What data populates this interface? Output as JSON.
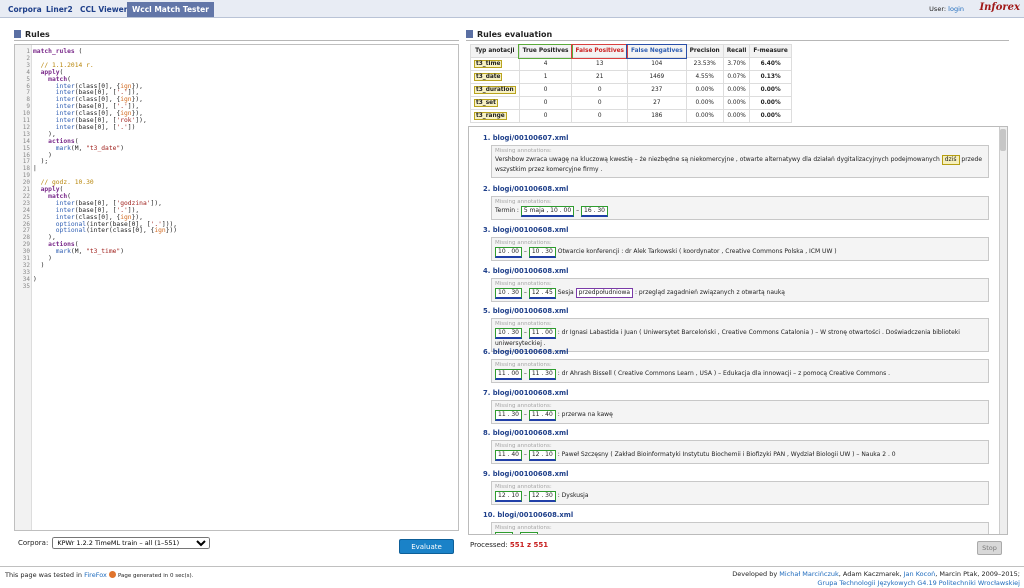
{
  "nav": {
    "tabs": [
      "Corpora",
      "Liner2",
      "CCL Viewer",
      "Wccl Match Tester"
    ],
    "active": 3,
    "user_label": "User:",
    "user_name": "login",
    "logo": "Inforex"
  },
  "rules_panel": {
    "title": "Rules"
  },
  "code_lines": [
    [
      {
        "t": "match_rules",
        "c": "kw"
      },
      {
        "t": " ("
      }
    ],
    [],
    [
      {
        "t": "  // 1.1.2014 r.",
        "c": "cm"
      }
    ],
    [
      {
        "t": "  apply",
        "c": "kw"
      },
      {
        "t": "("
      }
    ],
    [
      {
        "t": "    match",
        "c": "kw"
      },
      {
        "t": "("
      }
    ],
    [
      {
        "t": "      inter",
        "c": "fn"
      },
      {
        "t": "(class[0], {"
      },
      {
        "t": "ign",
        "c": "nm"
      },
      {
        "t": "}),"
      }
    ],
    [
      {
        "t": "      inter",
        "c": "fn"
      },
      {
        "t": "(base[0], ["
      },
      {
        "t": "'.'",
        "c": "st"
      },
      {
        "t": "]),"
      }
    ],
    [
      {
        "t": "      inter",
        "c": "fn"
      },
      {
        "t": "(class[0], {"
      },
      {
        "t": "ign",
        "c": "nm"
      },
      {
        "t": "}),"
      }
    ],
    [
      {
        "t": "      inter",
        "c": "fn"
      },
      {
        "t": "(base[0], ["
      },
      {
        "t": "'.'",
        "c": "st"
      },
      {
        "t": "]),"
      }
    ],
    [
      {
        "t": "      inter",
        "c": "fn"
      },
      {
        "t": "(class[0], {"
      },
      {
        "t": "ign",
        "c": "nm"
      },
      {
        "t": "}),"
      }
    ],
    [
      {
        "t": "      inter",
        "c": "fn"
      },
      {
        "t": "(base[0], ["
      },
      {
        "t": "'rok'",
        "c": "st"
      },
      {
        "t": "]),"
      }
    ],
    [
      {
        "t": "      inter",
        "c": "fn"
      },
      {
        "t": "(base[0], ["
      },
      {
        "t": "'.'",
        "c": "st"
      },
      {
        "t": "])"
      }
    ],
    [
      {
        "t": "    ),"
      }
    ],
    [
      {
        "t": "    actions",
        "c": "kw"
      },
      {
        "t": "("
      }
    ],
    [
      {
        "t": "      mark",
        "c": "fn"
      },
      {
        "t": "(M, "
      },
      {
        "t": "\"t3_date\"",
        "c": "st"
      },
      {
        "t": ")"
      }
    ],
    [
      {
        "t": "    )"
      }
    ],
    [
      {
        "t": "  );"
      }
    ],
    [
      {
        "t": "|"
      }
    ],
    [],
    [
      {
        "t": "  // godz. 10.30",
        "c": "cm"
      }
    ],
    [
      {
        "t": "  apply",
        "c": "kw"
      },
      {
        "t": "("
      }
    ],
    [
      {
        "t": "    match",
        "c": "kw"
      },
      {
        "t": "("
      }
    ],
    [
      {
        "t": "      inter",
        "c": "fn"
      },
      {
        "t": "(base[0], ["
      },
      {
        "t": "'godzina'",
        "c": "st"
      },
      {
        "t": "]),"
      }
    ],
    [
      {
        "t": "      inter",
        "c": "fn"
      },
      {
        "t": "(base[0], ["
      },
      {
        "t": "'.'",
        "c": "st"
      },
      {
        "t": "]),"
      }
    ],
    [
      {
        "t": "      inter",
        "c": "fn"
      },
      {
        "t": "(class[0], {"
      },
      {
        "t": "ign",
        "c": "nm"
      },
      {
        "t": "}),"
      }
    ],
    [
      {
        "t": "      optional",
        "c": "fn"
      },
      {
        "t": "(inter(base[0], ["
      },
      {
        "t": "'.'",
        "c": "st"
      },
      {
        "t": "])),"
      }
    ],
    [
      {
        "t": "      optional",
        "c": "fn"
      },
      {
        "t": "(inter(class[0], {"
      },
      {
        "t": "ign",
        "c": "nm"
      },
      {
        "t": "}))"
      }
    ],
    [
      {
        "t": "    ),"
      }
    ],
    [
      {
        "t": "    actions",
        "c": "kw"
      },
      {
        "t": "("
      }
    ],
    [
      {
        "t": "      mark",
        "c": "fn"
      },
      {
        "t": "(M, "
      },
      {
        "t": "\"t3_time\"",
        "c": "st"
      },
      {
        "t": ")"
      }
    ],
    [
      {
        "t": "    )"
      }
    ],
    [
      {
        "t": "  )"
      }
    ],
    [],
    [
      {
        "t": ")"
      }
    ],
    []
  ],
  "corpus": {
    "label": "Corpora:",
    "selected": "KPWr 1.2.2 TimeML train – all (1–551)"
  },
  "evaluate_label": "Evaluate",
  "eval_panel": {
    "title": "Rules evaluation"
  },
  "stats": {
    "headers": [
      "Typ anotacji",
      "True Positives",
      "False Positives",
      "False Negatives",
      "Precision",
      "Recall",
      "F-measure"
    ],
    "rows": [
      [
        "t3_time",
        "4",
        "13",
        "104",
        "23.53%",
        "3.70%",
        "6.40%"
      ],
      [
        "t3_date",
        "1",
        "21",
        "1469",
        "4.55%",
        "0.07%",
        "0.13%"
      ],
      [
        "t3_duration",
        "0",
        "0",
        "237",
        "0.00%",
        "0.00%",
        "0.00%"
      ],
      [
        "t3_set",
        "0",
        "0",
        "27",
        "0.00%",
        "0.00%",
        "0.00%"
      ],
      [
        "t3_range",
        "0",
        "0",
        "186",
        "0.00%",
        "0.00%",
        "0.00%"
      ]
    ]
  },
  "missing_label": "Missing annotations:",
  "results": [
    {
      "n": "1.",
      "file": "blogi/00100607.xml",
      "parts": [
        {
          "t": "Vershbow zwraca uwagę na kluczową kwestię – że niezbędne są niekomercyjne , otwarte alternatywy dla działań dygitalizacyjnych podejmowanych "
        },
        {
          "t": "dziś",
          "k": "dt"
        },
        {
          "t": " przede wszystkim przez komercyjne firmy ."
        }
      ]
    },
    {
      "n": "2.",
      "file": "blogi/00100608.xml",
      "parts": [
        {
          "t": "Termin : "
        },
        {
          "t": "5 maja , 10 . 00",
          "k": "tm"
        },
        {
          "t": " – "
        },
        {
          "t": "16 . 30",
          "k": "tm"
        }
      ]
    },
    {
      "n": "3.",
      "file": "blogi/00100608.xml",
      "parts": [
        {
          "t": "10 . 00",
          "k": "tm"
        },
        {
          "t": " – "
        },
        {
          "t": "10 . 30",
          "k": "tm"
        },
        {
          "t": " Otwarcie konferencji : dr Alek Tarkowski ( koordynator , Creative Commons Polska , ICM UW )"
        }
      ]
    },
    {
      "n": "4.",
      "file": "blogi/00100608.xml",
      "parts": [
        {
          "t": "10 . 30",
          "k": "tm"
        },
        {
          "t": " – "
        },
        {
          "t": "12 . 45",
          "k": "tm"
        },
        {
          "t": " Sesja "
        },
        {
          "t": "przedpołudniowa",
          "k": "pl"
        },
        {
          "t": " : przegląd zagadnień związanych z otwartą nauką"
        }
      ]
    },
    {
      "n": "5.",
      "file": "blogi/00100608.xml",
      "parts": [
        {
          "t": "10 . 30",
          "k": "tm"
        },
        {
          "t": " – "
        },
        {
          "t": "11 . 00",
          "k": "tm"
        },
        {
          "t": " : dr Ignasi Labastida i Juan ( Uniwersytet Barceloński , Creative Commons Catalonia ) – W stronę otwartości . Doświadczenia biblioteki uniwersyteckiej ."
        }
      ]
    },
    {
      "n": "6.",
      "file": "blogi/00100608.xml",
      "parts": [
        {
          "t": "11 . 00",
          "k": "tm"
        },
        {
          "t": " – "
        },
        {
          "t": "11 . 30",
          "k": "tm"
        },
        {
          "t": " : dr Ahrash Bissell ( Creative Commons Learn , USA ) – Edukacja dla innowacji – z pomocą Creative Commons ."
        }
      ]
    },
    {
      "n": "7.",
      "file": "blogi/00100608.xml",
      "parts": [
        {
          "t": "11 . 30",
          "k": "tm"
        },
        {
          "t": " – "
        },
        {
          "t": "11 . 40",
          "k": "tm"
        },
        {
          "t": " : przerwa na kawę"
        }
      ]
    },
    {
      "n": "8.",
      "file": "blogi/00100608.xml",
      "parts": [
        {
          "t": "11 . 40",
          "k": "tm"
        },
        {
          "t": " – "
        },
        {
          "t": "12 . 10",
          "k": "tm"
        },
        {
          "t": " : Paweł Szczęsny ( Zakład Bioinformatyki Instytutu Biochemii i Biofizyki PAN , Wydział Biologii UW ) – Nauka 2 . 0"
        }
      ]
    },
    {
      "n": "9.",
      "file": "blogi/00100608.xml",
      "parts": [
        {
          "t": "12 . 10",
          "k": "tm"
        },
        {
          "t": " – "
        },
        {
          "t": "12 . 30",
          "k": "tm"
        },
        {
          "t": " : Dyskusja"
        }
      ]
    },
    {
      "n": "10.",
      "file": "blogi/00100608.xml",
      "parts": [
        {
          "t": "",
          "k": "tm"
        },
        {
          "t": " – "
        },
        {
          "t": "",
          "k": "tm"
        }
      ]
    }
  ],
  "processed": {
    "label": "Processed:",
    "value": "551 z 551"
  },
  "stop_label": "Stop",
  "footer": {
    "tested_pre": "This page was tested in",
    "browser": "FireFox",
    "generated": "Page generated in 0 sec(s).",
    "developed": "Developed by",
    "authors": [
      "Michał Marcińczuk",
      ", Adam Kaczmarek, ",
      "Jan Kocoń",
      ", Marcin Ptak, 2009–2015;"
    ],
    "group": "Grupa Technologii Językowych G4.19 Politechniki Wrocławskiej"
  }
}
